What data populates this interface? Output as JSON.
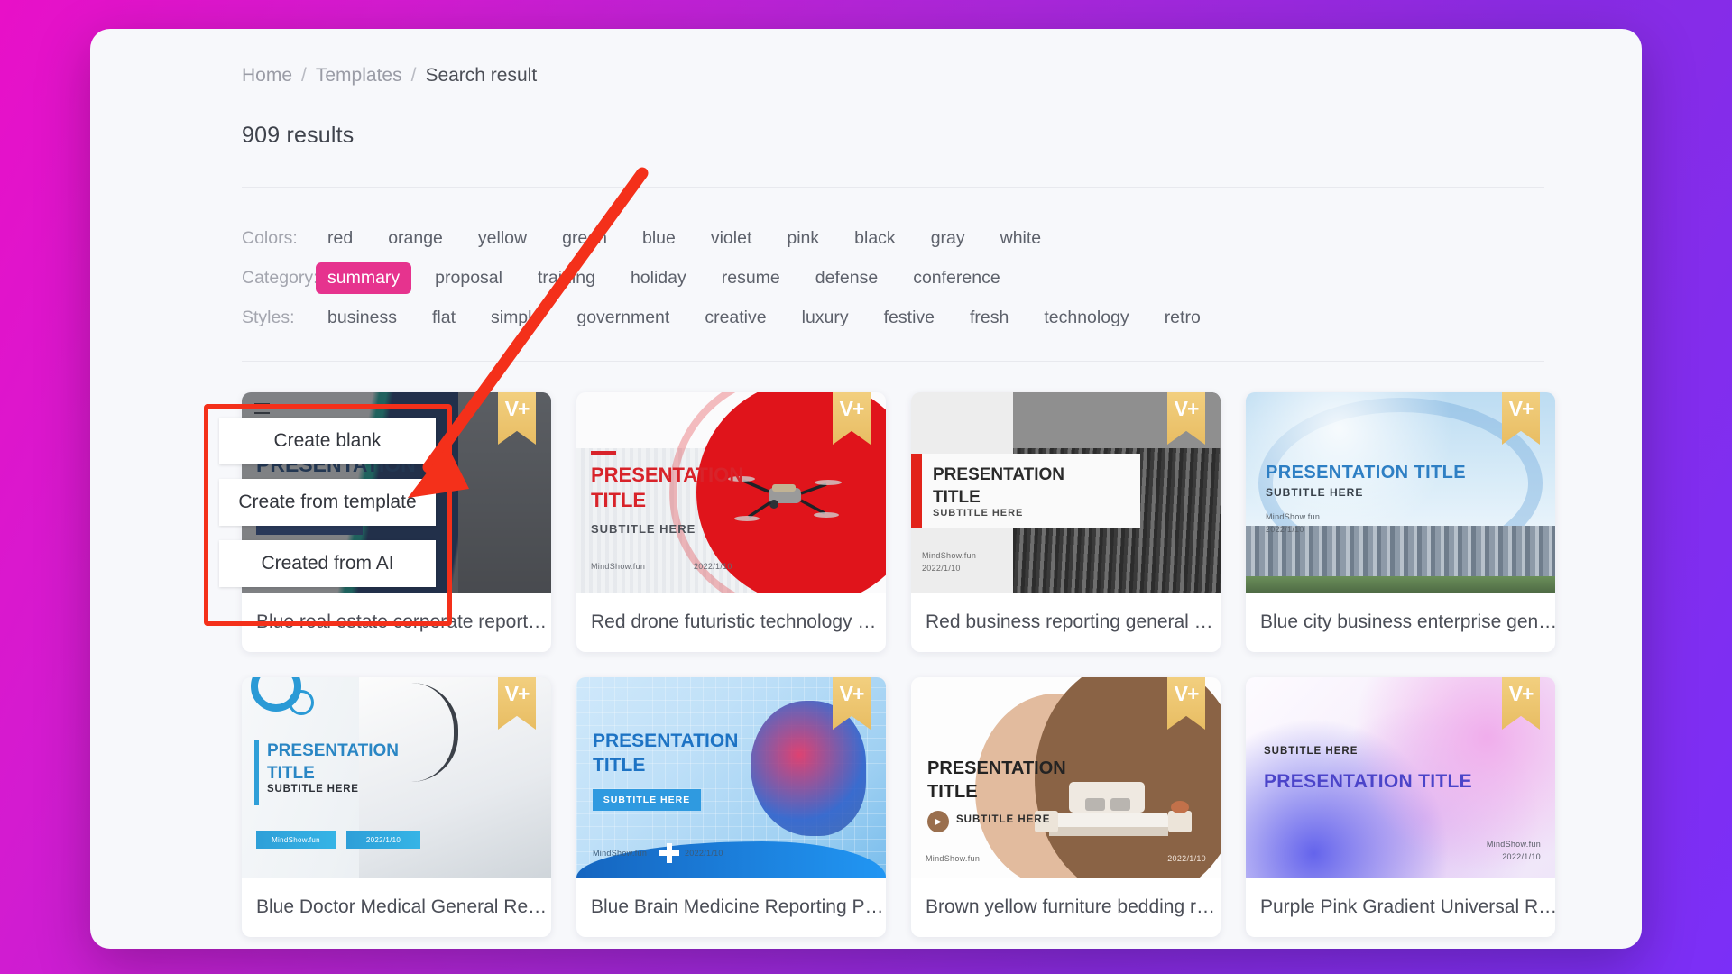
{
  "breadcrumb": {
    "items": [
      "Home",
      "Templates",
      "Search result"
    ],
    "separator": "/"
  },
  "results": {
    "count_label": "909 results"
  },
  "filters": [
    {
      "label": "Colors:",
      "name": "colors",
      "options": [
        "red",
        "orange",
        "yellow",
        "green",
        "blue",
        "violet",
        "pink",
        "black",
        "gray",
        "white"
      ],
      "active": null
    },
    {
      "label": "Category:",
      "name": "category",
      "options": [
        "summary",
        "proposal",
        "training",
        "holiday",
        "resume",
        "defense",
        "conference"
      ],
      "active": "summary"
    },
    {
      "label": "Styles:",
      "name": "styles",
      "options": [
        "business",
        "flat",
        "simple",
        "government",
        "creative",
        "luxury",
        "festive",
        "fresh",
        "technology",
        "retro"
      ],
      "active": null
    }
  ],
  "accent_color": "#e6338e",
  "annotation_color": "#f4301a",
  "context_menu": {
    "items": [
      {
        "label": "Create blank"
      },
      {
        "label": "Create from template"
      },
      {
        "label": "Created from AI"
      }
    ]
  },
  "badge": {
    "label": "V+",
    "name": "vip-badge"
  },
  "slide_text": {
    "title": "PRESENTATION TITLE",
    "title_line1": "PRESENTATION",
    "title_line2": "TITLE",
    "subtitle": "SUBTITLE HERE",
    "brand": "MindShow.fun",
    "date": "2022/1/10"
  },
  "cards": [
    {
      "title": "Blue real estate corporate report…",
      "vip": true,
      "selected": true
    },
    {
      "title": "Red drone futuristic technology …",
      "vip": true,
      "selected": false
    },
    {
      "title": "Red business reporting general …",
      "vip": true,
      "selected": false
    },
    {
      "title": "Blue city business enterprise gen…",
      "vip": true,
      "selected": false
    },
    {
      "title": "Blue Doctor Medical General Re…",
      "vip": true,
      "selected": false
    },
    {
      "title": "Blue Brain Medicine Reporting P…",
      "vip": true,
      "selected": false
    },
    {
      "title": "Brown yellow furniture bedding r…",
      "vip": true,
      "selected": false
    },
    {
      "title": "Purple Pink Gradient Universal R…",
      "vip": true,
      "selected": false
    }
  ]
}
